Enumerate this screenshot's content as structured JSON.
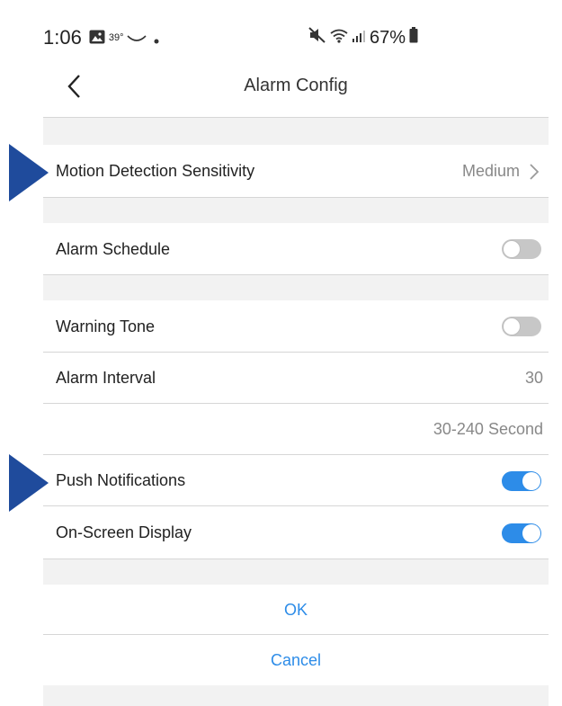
{
  "status_bar": {
    "time": "1:06",
    "temperature": "39°",
    "battery": "67%"
  },
  "header": {
    "title": "Alarm Config"
  },
  "settings": {
    "motion_detection": {
      "label": "Motion Detection Sensitivity",
      "value": "Medium"
    },
    "alarm_schedule": {
      "label": "Alarm Schedule",
      "enabled": false
    },
    "warning_tone": {
      "label": "Warning Tone",
      "enabled": false
    },
    "alarm_interval": {
      "label": "Alarm Interval",
      "value": "30",
      "hint": "30-240 Second"
    },
    "push_notifications": {
      "label": "Push Notifications",
      "enabled": true
    },
    "on_screen_display": {
      "label": "On-Screen Display",
      "enabled": true
    }
  },
  "actions": {
    "ok_label": "OK",
    "cancel_label": "Cancel"
  },
  "colors": {
    "accent": "#2d8ce8",
    "marker": "#1f4b9c"
  }
}
